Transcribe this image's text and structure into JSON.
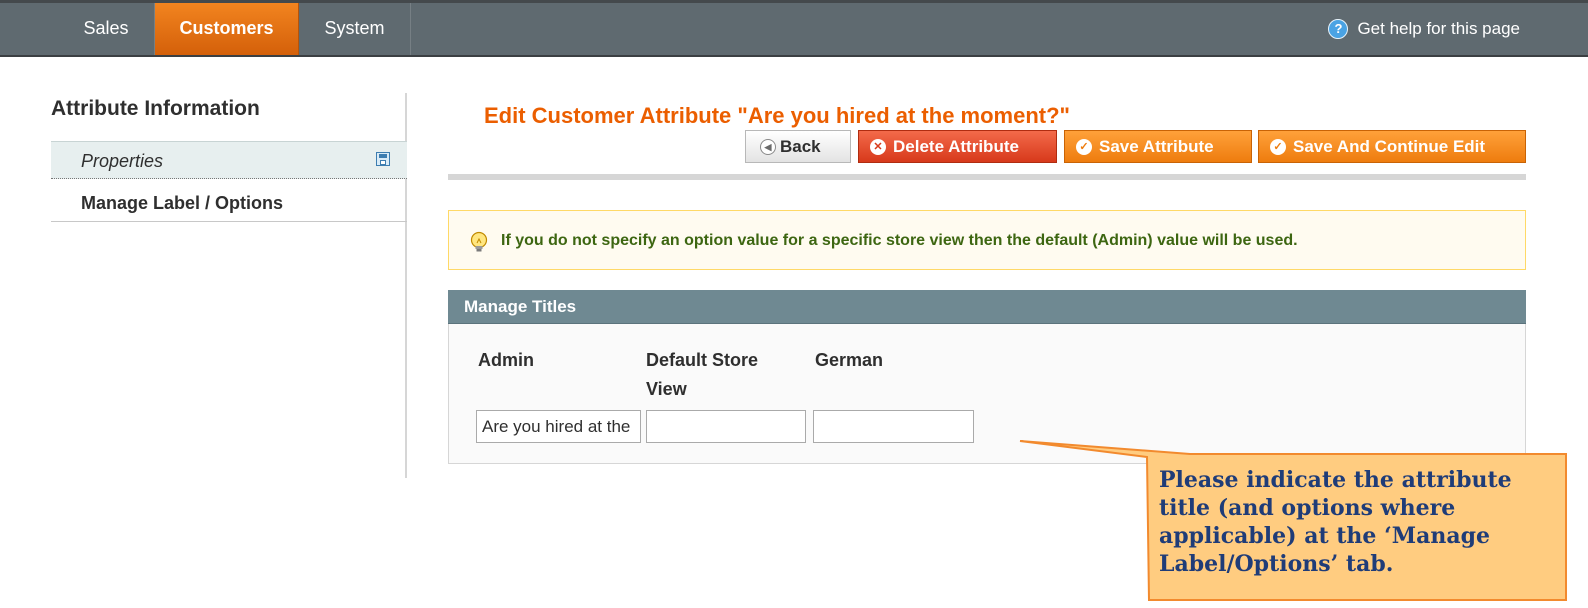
{
  "nav": {
    "tabs": [
      {
        "label": "Sales"
      },
      {
        "label": "Customers",
        "active": true
      },
      {
        "label": "System"
      }
    ],
    "help_label": "Get help for this page",
    "help_icon": "help-icon"
  },
  "sidebar": {
    "title": "Attribute Information",
    "items": [
      {
        "label": "Properties",
        "icon": "save-icon"
      },
      {
        "label": "Manage Label / Options",
        "active": true
      }
    ]
  },
  "header": {
    "title": "Edit Customer Attribute \"Are you hired at the moment?\"",
    "buttons": {
      "back": "Back",
      "delete": "Delete Attribute",
      "save": "Save Attribute",
      "save_continue": "Save And Continue Edit"
    }
  },
  "notice": {
    "text": "If you do not specify an option value for a specific store view then the default (Admin) value will be used.",
    "icon": "lightbulb-icon"
  },
  "manage_titles": {
    "heading": "Manage Titles",
    "columns": [
      "Admin",
      "Default Store View",
      "German"
    ],
    "values": {
      "admin": "Are you hired at the moment?",
      "default_store_view": "",
      "german": ""
    }
  },
  "callout": {
    "text": "Please indicate the attribute title (and options where applicable) at the ‘Manage Label/Options’ tab."
  },
  "colors": {
    "accent_orange": "#eb5e00",
    "nav_bg": "#5f6a70",
    "section_head": "#6f8992",
    "notice_bg": "#fffbf0",
    "callout_fill": "#ffcc80",
    "callout_border": "#f28a2e",
    "callout_text": "#1f3c78"
  }
}
